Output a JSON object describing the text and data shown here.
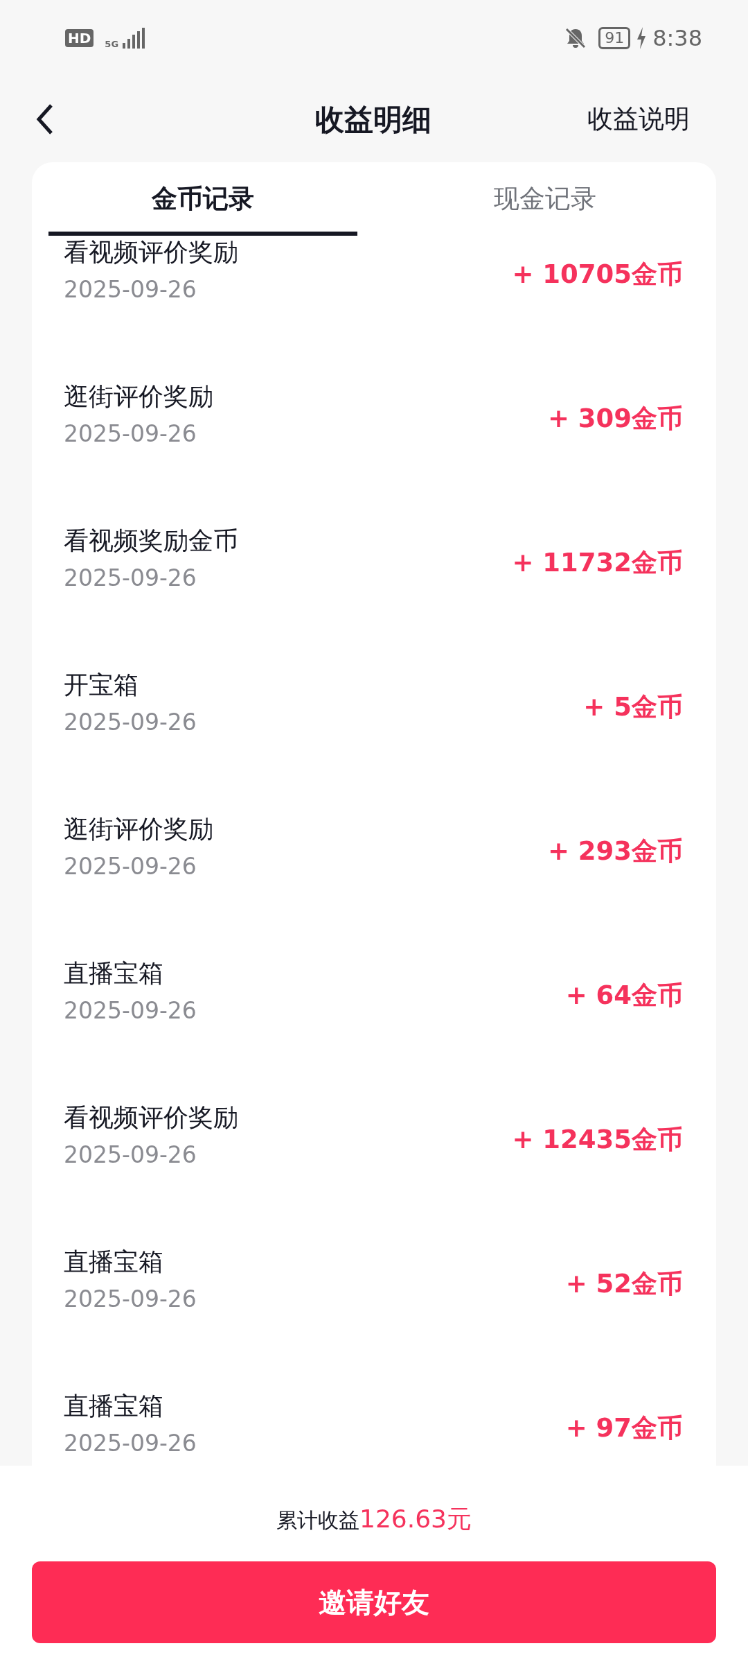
{
  "status_bar": {
    "network_badge": "HD",
    "network_type": "5G",
    "battery": "91",
    "charging": true,
    "time": "8:38"
  },
  "header": {
    "title": "收益明细",
    "action": "收益说明"
  },
  "tabs": [
    {
      "label": "金币记录",
      "selected": true
    },
    {
      "label": "现金记录",
      "selected": false
    }
  ],
  "records": [
    {
      "title": "看视频评价奖励",
      "date": "2025-09-26",
      "amount": "+ 10705金币"
    },
    {
      "title": "逛街评价奖励",
      "date": "2025-09-26",
      "amount": "+ 309金币"
    },
    {
      "title": "看视频奖励金币",
      "date": "2025-09-26",
      "amount": "+ 11732金币"
    },
    {
      "title": "开宝箱",
      "date": "2025-09-26",
      "amount": "+ 5金币"
    },
    {
      "title": "逛街评价奖励",
      "date": "2025-09-26",
      "amount": "+ 293金币"
    },
    {
      "title": "直播宝箱",
      "date": "2025-09-26",
      "amount": "+ 64金币"
    },
    {
      "title": "看视频评价奖励",
      "date": "2025-09-26",
      "amount": "+ 12435金币"
    },
    {
      "title": "直播宝箱",
      "date": "2025-09-26",
      "amount": "+ 52金币"
    },
    {
      "title": "直播宝箱",
      "date": "2025-09-26",
      "amount": "+ 97金币"
    }
  ],
  "footer": {
    "total_label": "累计收益",
    "total_value": "126.63元",
    "button": "邀请好友"
  }
}
